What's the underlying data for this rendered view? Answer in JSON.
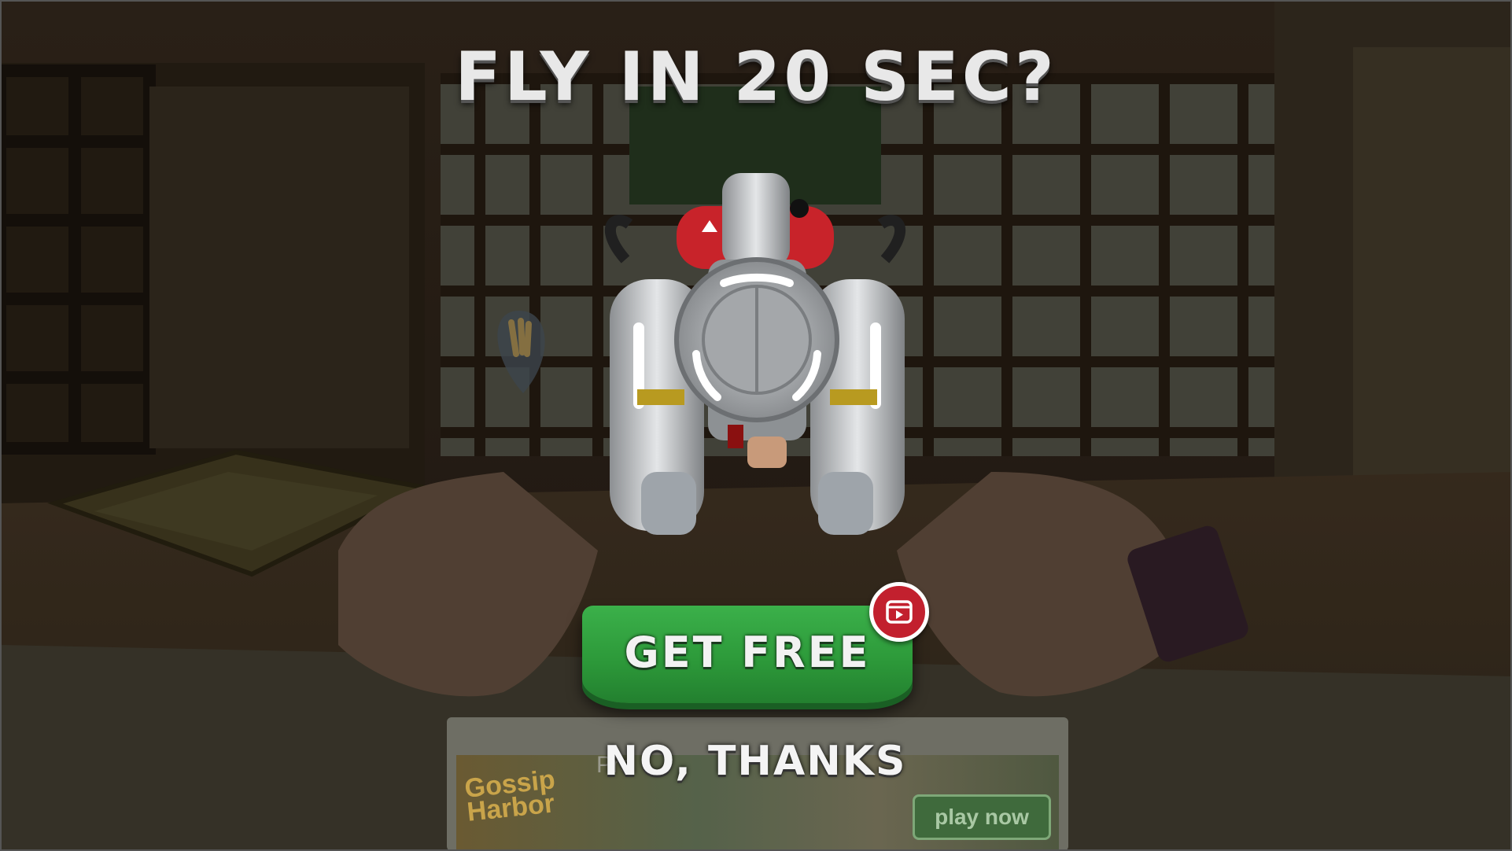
{
  "title": "FLY IN 20 SEC?",
  "get_free_label": "GET FREE",
  "no_thanks_label": "NO, THANKS",
  "ad": {
    "label": "Pro",
    "logo_line1": "Gossip",
    "logo_line2": "Harbor",
    "play_label": "play now"
  },
  "icons": {
    "video_badge": "video-ad-icon",
    "item": "jetpack-icon",
    "hint": "hand-hint-icon"
  },
  "colors": {
    "button_green": "#2d9a3a",
    "badge_red": "#c2202e",
    "jetpack_tank": "#c8232a"
  }
}
